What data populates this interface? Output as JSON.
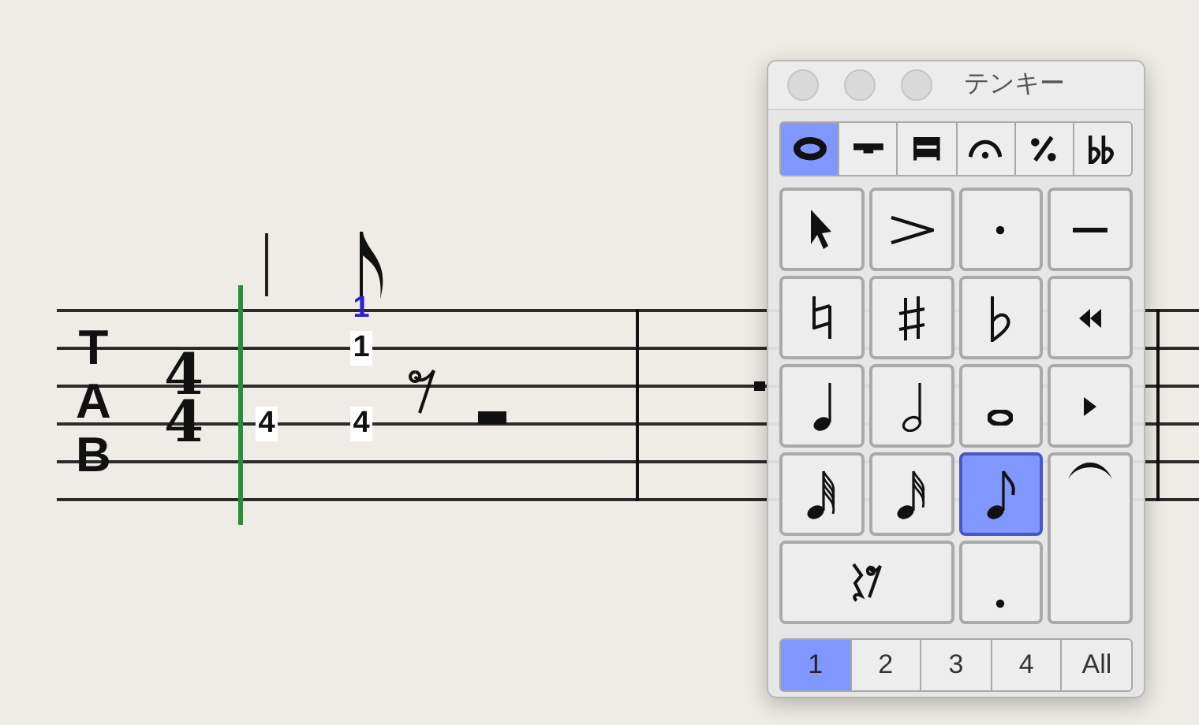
{
  "score": {
    "clef": [
      "T",
      "A",
      "B"
    ],
    "time_signature": [
      "4",
      "4"
    ],
    "frets": [
      {
        "text": "1",
        "active": true
      },
      {
        "text": "1",
        "active": false
      },
      {
        "text": "4",
        "active": false
      },
      {
        "text": "4",
        "active": false
      }
    ]
  },
  "palette": {
    "title": "テンキー",
    "mode_tabs": [
      {
        "kind": "notes",
        "selected": true
      },
      {
        "kind": "bar",
        "selected": false
      },
      {
        "kind": "beam",
        "selected": false
      },
      {
        "kind": "fermata",
        "selected": false
      },
      {
        "kind": "repeat",
        "selected": false
      },
      {
        "kind": "double-flat",
        "selected": false
      }
    ],
    "keys": [
      {
        "kind": "pointer",
        "selected": false
      },
      {
        "kind": "accent",
        "selected": false
      },
      {
        "kind": "staccato",
        "selected": false
      },
      {
        "kind": "tenuto",
        "selected": false
      },
      {
        "kind": "natural",
        "selected": false
      },
      {
        "kind": "sharp",
        "selected": false
      },
      {
        "kind": "flat",
        "selected": false
      },
      {
        "kind": "rewind",
        "selected": false
      },
      {
        "kind": "quarter",
        "selected": false
      },
      {
        "kind": "half",
        "selected": false
      },
      {
        "kind": "whole",
        "selected": false
      },
      {
        "kind": "play",
        "selected": false
      },
      {
        "kind": "sixty-fourth",
        "selected": false
      },
      {
        "kind": "thirty-second",
        "selected": false
      },
      {
        "kind": "eighth",
        "selected": true
      },
      {
        "kind": "tie",
        "selected": false
      },
      {
        "kind": "rests",
        "selected": false
      },
      {
        "kind": "dot",
        "selected": false
      }
    ],
    "voices": [
      {
        "label": "1",
        "selected": true
      },
      {
        "label": "2",
        "selected": false
      },
      {
        "label": "3",
        "selected": false
      },
      {
        "label": "4",
        "selected": false
      },
      {
        "label": "All",
        "selected": false
      }
    ]
  }
}
